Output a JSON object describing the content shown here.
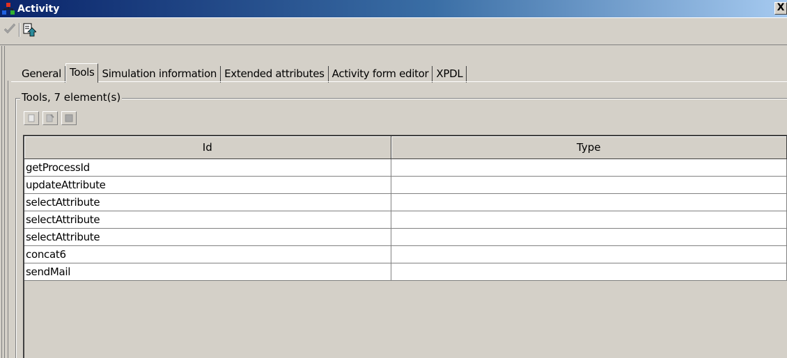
{
  "window": {
    "title": "Activity",
    "close_label": "X"
  },
  "toolbar": {
    "check_icon": "check-icon",
    "export_icon": "export-icon"
  },
  "tabs": [
    {
      "label": "General",
      "active": false
    },
    {
      "label": "Tools",
      "active": true
    },
    {
      "label": "Simulation information",
      "active": false
    },
    {
      "label": "Extended attributes",
      "active": false
    },
    {
      "label": "Activity form editor",
      "active": false
    },
    {
      "label": "XPDL",
      "active": false
    }
  ],
  "group": {
    "legend": "Tools, 7 element(s)",
    "buttons": [
      "new-icon",
      "edit-icon",
      "delete-icon"
    ]
  },
  "table": {
    "columns": [
      "Id",
      "Type"
    ],
    "rows": [
      {
        "id": "getProcessId",
        "type": ""
      },
      {
        "id": "updateAttribute",
        "type": ""
      },
      {
        "id": "selectAttribute",
        "type": ""
      },
      {
        "id": "selectAttribute",
        "type": ""
      },
      {
        "id": "selectAttribute",
        "type": ""
      },
      {
        "id": "concat6",
        "type": ""
      },
      {
        "id": "sendMail",
        "type": ""
      }
    ]
  },
  "colors": {
    "titlebar_start": "#0a246a",
    "titlebar_end": "#a6caf0",
    "face": "#d4d0c8"
  }
}
